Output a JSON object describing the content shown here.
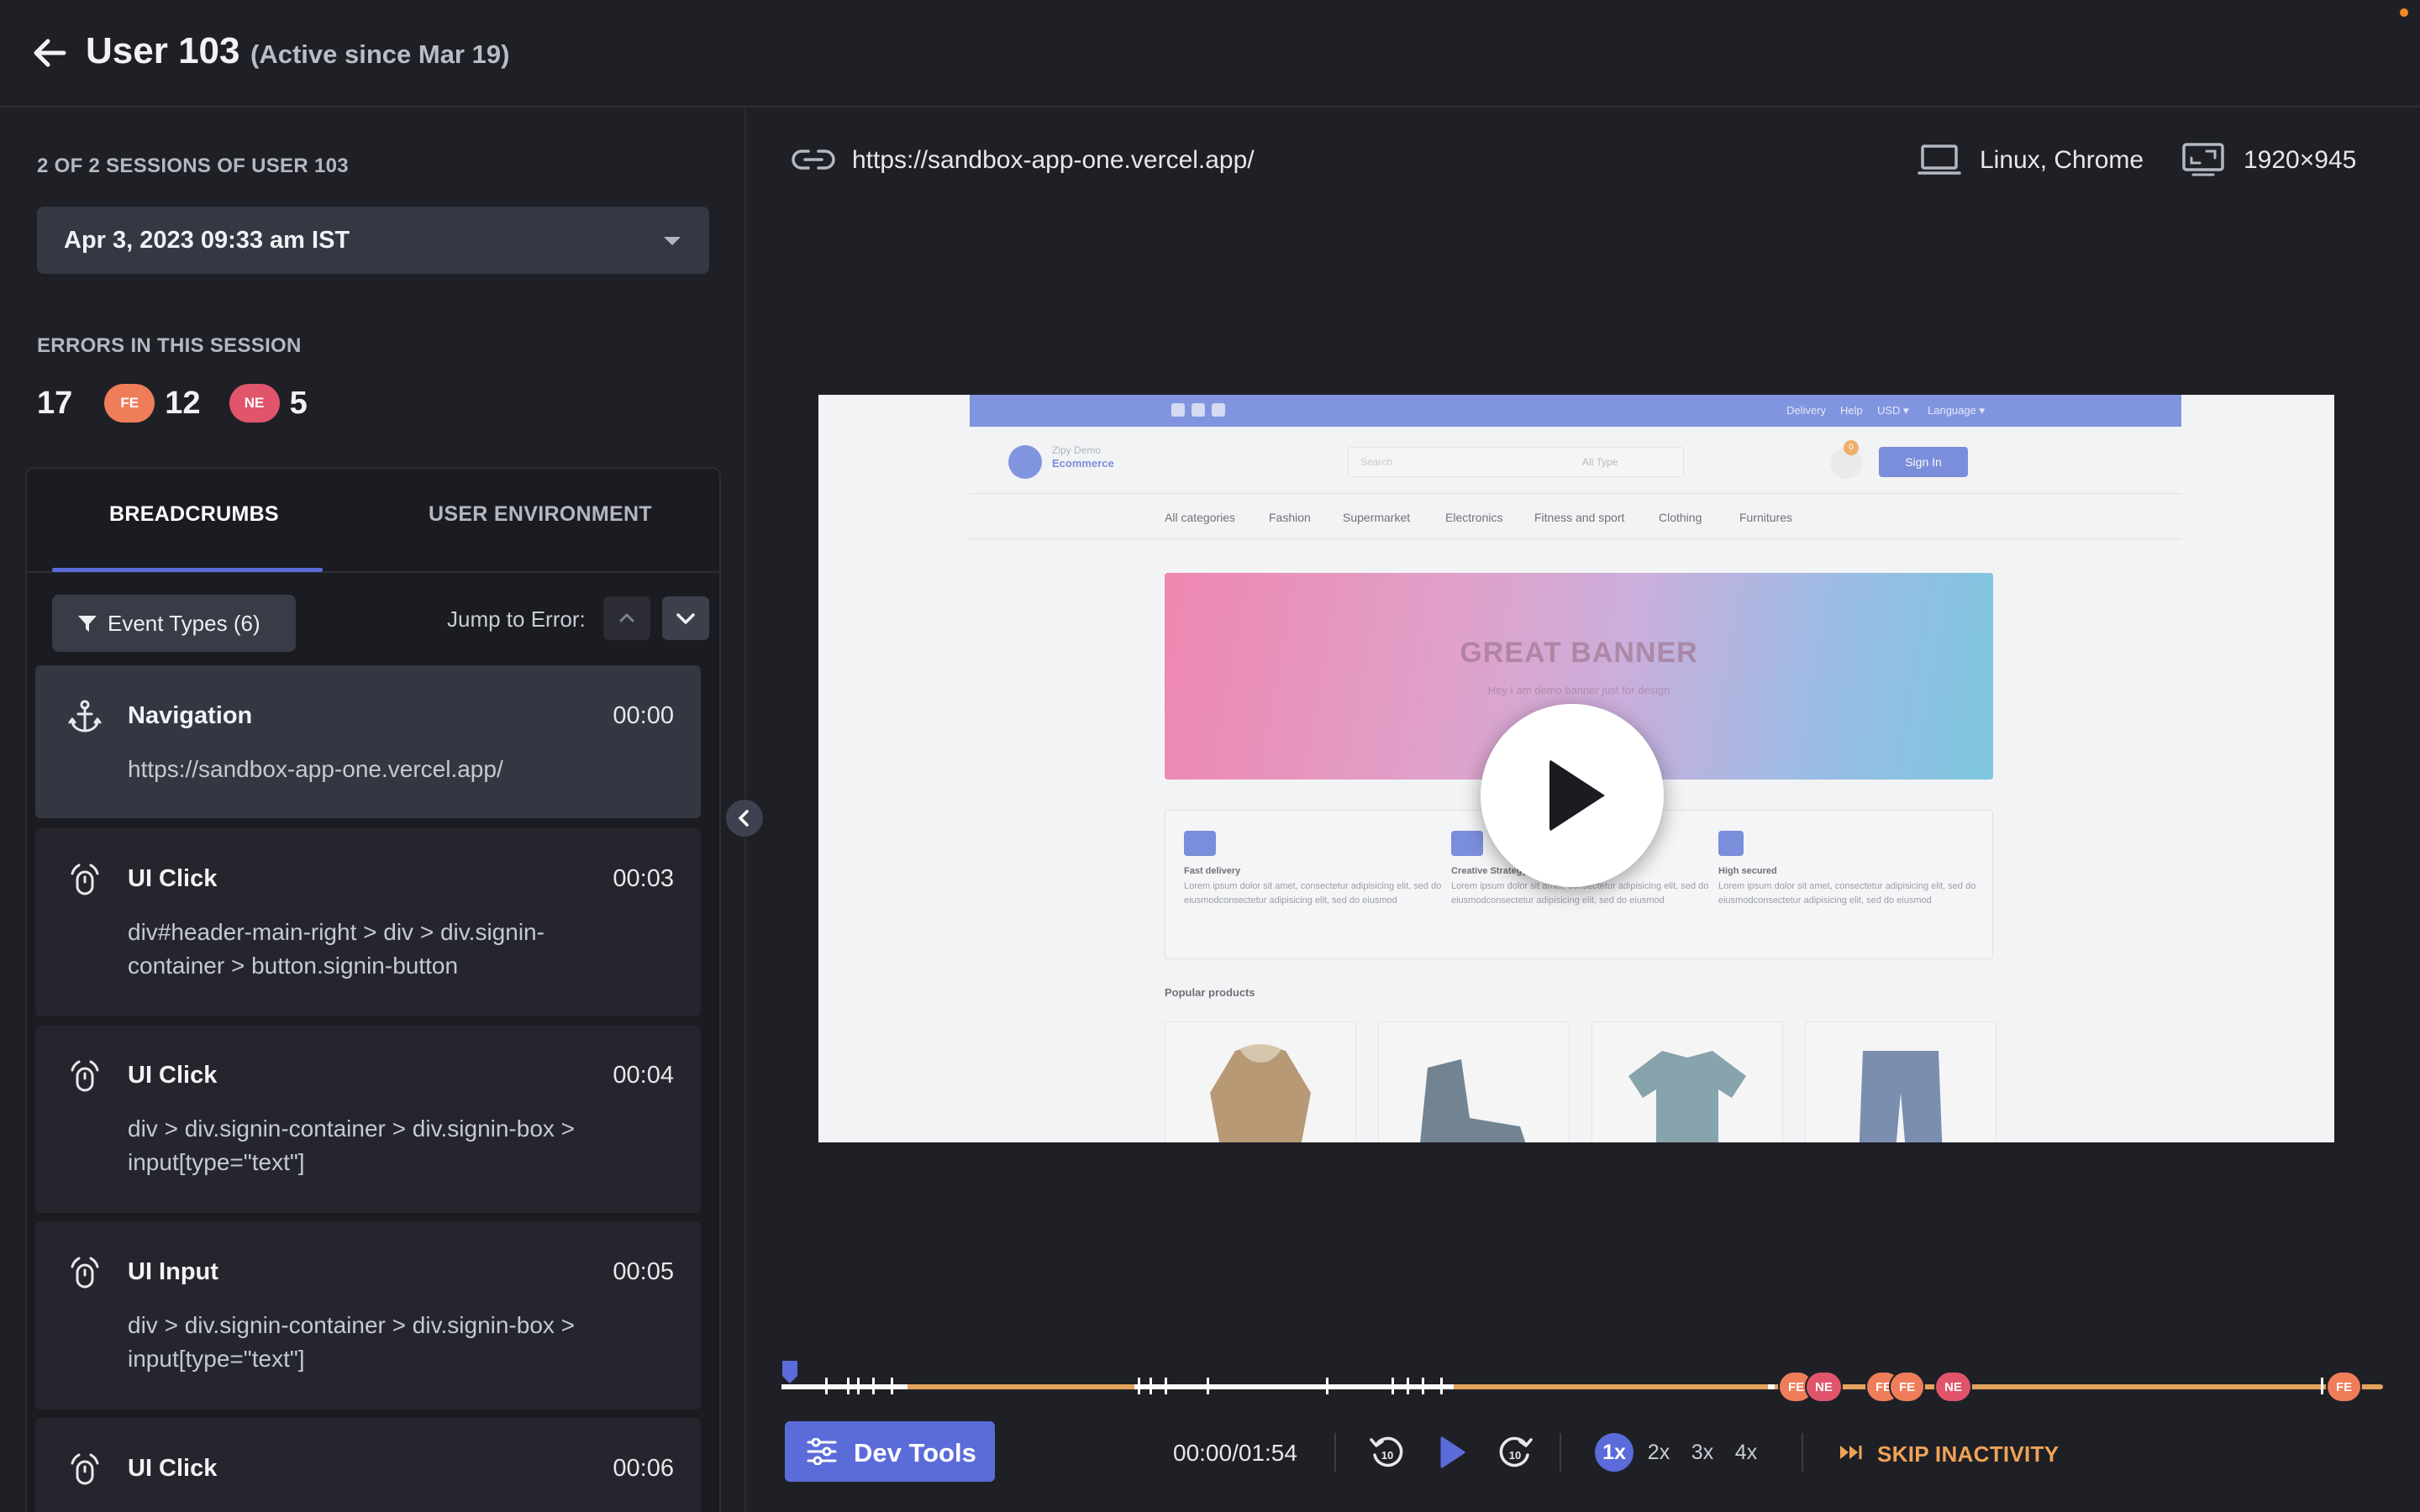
{
  "header": {
    "title": "User 103",
    "subtitle": "(Active since Mar 19)"
  },
  "sessions": {
    "label": "2 OF 2 SESSIONS OF USER 103",
    "selected": "Apr 3, 2023 09:33 am IST"
  },
  "errors": {
    "label": "ERRORS IN THIS SESSION",
    "total": "17",
    "fe_badge": "FE",
    "fe_count": "12",
    "ne_badge": "NE",
    "ne_count": "5"
  },
  "tabs": {
    "breadcrumbs": "BREADCRUMBS",
    "user_environment": "USER ENVIRONMENT"
  },
  "filters": {
    "event_types": "Event Types (6)",
    "jump_to_error": "Jump to Error:"
  },
  "breadcrumbs": [
    {
      "icon": "anchor-icon",
      "title": "Navigation",
      "time": "00:00",
      "detail": "https://sandbox-app-one.vercel.app/"
    },
    {
      "icon": "mouse-click-icon",
      "title": "UI Click",
      "time": "00:03",
      "detail": "div#header-main-right > div > div.signin-container > button.signin-button"
    },
    {
      "icon": "mouse-click-icon",
      "title": "UI Click",
      "time": "00:04",
      "detail": "div > div.signin-container > div.signin-box > input[type=\"text\"]"
    },
    {
      "icon": "mouse-click-icon",
      "title": "UI Input",
      "time": "00:05",
      "detail": "div > div.signin-container > div.signin-box > input[type=\"text\"]"
    },
    {
      "icon": "mouse-click-icon",
      "title": "UI Click",
      "time": "00:06",
      "detail": ""
    }
  ],
  "player": {
    "url": "https://sandbox-app-one.vercel.app/",
    "environment": "Linux, Chrome",
    "resolution": "1920×945",
    "time": "00:00/01:54",
    "progress": 0.0,
    "speeds": [
      "1x",
      "2x",
      "3x",
      "4x"
    ],
    "active_speed": "1x",
    "dev_tools": "Dev Tools",
    "skip_inactivity": "SKIP INACTIVITY",
    "timeline_badges": [
      {
        "type": "fe",
        "label": "FE"
      },
      {
        "type": "ne",
        "label": "NE"
      },
      {
        "type": "fe",
        "label": "FE"
      },
      {
        "type": "fe",
        "label": "FE"
      },
      {
        "type": "ne",
        "label": "NE"
      },
      {
        "type": "fe",
        "label": "FE"
      }
    ]
  },
  "replay_site": {
    "top_links": [
      "Delivery",
      "Help",
      "USD ▾",
      "Language ▾"
    ],
    "brand": [
      "Zipy Demo",
      "Ecommerce"
    ],
    "search_placeholder": "Search",
    "search_select": "All Type",
    "cart_count": "0",
    "signin": "Sign In",
    "nav": [
      "All categories",
      "Fashion",
      "Supermarket",
      "Electronics",
      "Fitness and sport",
      "Clothing",
      "Furnitures"
    ],
    "banner_title": "GREAT BANNER",
    "banner_subtitle": "Hey I am demo banner just for design",
    "features": [
      {
        "title": "Fast delivery",
        "text": "Lorem ipsum dolor sit amet, consectetur adipisicing elit, sed do eiusmodconsectetur adipisicing elit, sed do eiusmod"
      },
      {
        "title": "Creative Strategy",
        "text": "Lorem ipsum dolor sit amet, consectetur adipisicing elit, sed do eiusmodconsectetur adipisicing elit, sed do eiusmod"
      },
      {
        "title": "High secured",
        "text": "Lorem ipsum dolor sit amet, consectetur adipisicing elit, sed do eiusmodconsectetur adipisicing elit, sed do eiusmod"
      }
    ],
    "popular_title": "Popular products"
  },
  "colors": {
    "accent": "#5b6bd9",
    "fe": "#ef7d5a",
    "ne": "#e0556b",
    "timeline": "#e4a35d",
    "skip": "#f0a357"
  }
}
